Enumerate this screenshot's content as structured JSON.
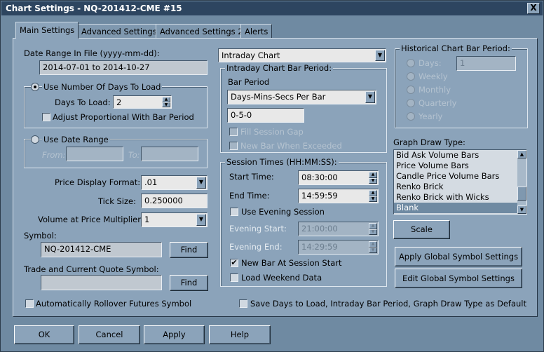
{
  "window": {
    "title": "Chart Settings - NQ-201412-CME  #15",
    "close_glyph": "X"
  },
  "tabs": [
    {
      "label": "Main Settings"
    },
    {
      "label": "Advanced Settings"
    },
    {
      "label": "Advanced Settings 2"
    },
    {
      "label": "Alerts"
    }
  ],
  "date_range": {
    "label": "Date Range In File (yyyy-mm-dd):",
    "value": "2014-07-01 to 2014-10-27"
  },
  "days_to_load": {
    "radio_label": "Use Number Of Days To Load",
    "label": "Days To Load:",
    "value": "2",
    "adjust_label": "Adjust Proportional With Bar Period"
  },
  "use_date_range": {
    "radio_label": "Use Date Range",
    "from_label": "From:",
    "to_label": "To:",
    "from_value": "",
    "to_value": ""
  },
  "price_display": {
    "label": "Price Display Format:",
    "value": ".01"
  },
  "tick_size": {
    "label": "Tick Size:",
    "value": "0.250000"
  },
  "volume_multiplier": {
    "label": "Volume at Price Multiplier:",
    "value": "1"
  },
  "symbol": {
    "label": "Symbol:",
    "value": "NQ-201412-CME",
    "find_label": "Find"
  },
  "quote_symbol": {
    "label": "Trade and Current Quote Symbol:",
    "value": "",
    "find_label": "Find"
  },
  "auto_rollover": {
    "label": "Automatically Rollover Futures Symbol"
  },
  "chart_type": {
    "value": "Intraday Chart"
  },
  "intraday_bar_period": {
    "group_label": "Intraday Chart Bar Period:",
    "bar_period_label": "Bar Period",
    "bar_period_type": "Days-Mins-Secs Per Bar",
    "bar_period_value": "0-5-0",
    "fill_session_gap": "Fill Session Gap",
    "new_bar_exceeded": "New Bar When Exceeded"
  },
  "session_times": {
    "group_label": "Session Times (HH:MM:SS):",
    "start_label": "Start Time:",
    "start_value": "08:30:00",
    "end_label": "End Time:",
    "end_value": "14:59:59",
    "evening_session_label": "Use Evening Session",
    "evening_start_label": "Evening Start:",
    "evening_start_value": "21:00:00",
    "evening_end_label": "Evening End:",
    "evening_end_value": "14:29:59",
    "new_bar_session_label": "New Bar At Session Start",
    "load_weekend_label": "Load Weekend Data"
  },
  "historical": {
    "group_label": "Historical Chart Bar Period:",
    "days_label": "Days:",
    "days_value": "1",
    "weekly": "Weekly",
    "monthly": "Monthly",
    "quarterly": "Quarterly",
    "yearly": "Yearly"
  },
  "graph_draw": {
    "label": "Graph Draw Type:",
    "items": [
      "Bid Ask Volume Bars",
      "Price Volume Bars",
      "Candle Price Volume Bars",
      "Renko Brick",
      "Renko Brick with Wicks",
      "Blank"
    ],
    "selected": "Blank"
  },
  "buttons": {
    "scale": "Scale",
    "apply_global": "Apply Global Symbol Settings",
    "edit_global": "Edit Global Symbol Settings",
    "ok": "OK",
    "cancel": "Cancel",
    "apply": "Apply",
    "help": "Help"
  },
  "save_defaults": {
    "label": "Save Days to Load, Intraday Bar Period, Graph Draw Type as Default"
  },
  "glyphs": {
    "check": "✔",
    "down": "▼",
    "up": "▲"
  },
  "colors": {
    "titlebar": "#2d4560",
    "panel": "#8ba3ba",
    "background": "#6f8aa2",
    "selection": "#6f8aa2"
  }
}
